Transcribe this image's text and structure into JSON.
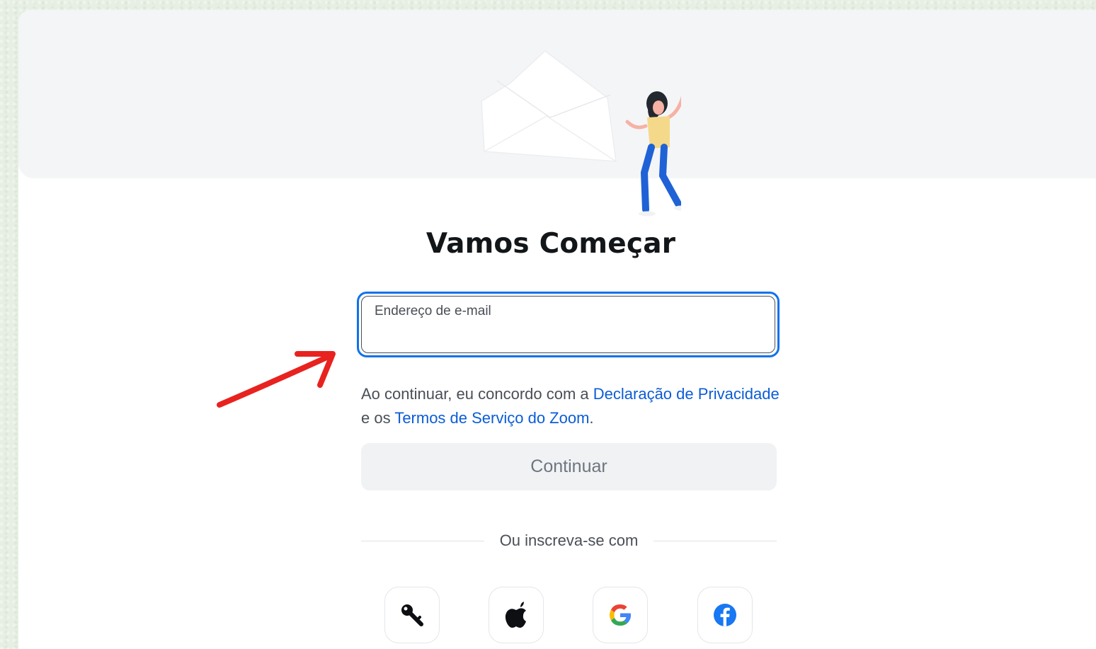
{
  "page": {
    "title": "Vamos Começar"
  },
  "email": {
    "label": "Endereço de e-mail",
    "value": ""
  },
  "terms": {
    "prefix": "Ao continuar, eu concordo com a ",
    "privacy_link": "Declaração de Privacidade",
    "middle": " e os ",
    "tos_link": "Termos de Serviço do Zoom",
    "suffix": "."
  },
  "actions": {
    "continue_label": "Continuar"
  },
  "signup": {
    "divider_label": "Ou inscreva-se com",
    "options": [
      {
        "icon": "key-icon"
      },
      {
        "icon": "apple-icon"
      },
      {
        "icon": "google-icon"
      },
      {
        "icon": "facebook-icon"
      }
    ]
  },
  "colors": {
    "accent": "#0e72ed",
    "link": "#0b5cd6",
    "annotation_arrow": "#e8221f"
  }
}
